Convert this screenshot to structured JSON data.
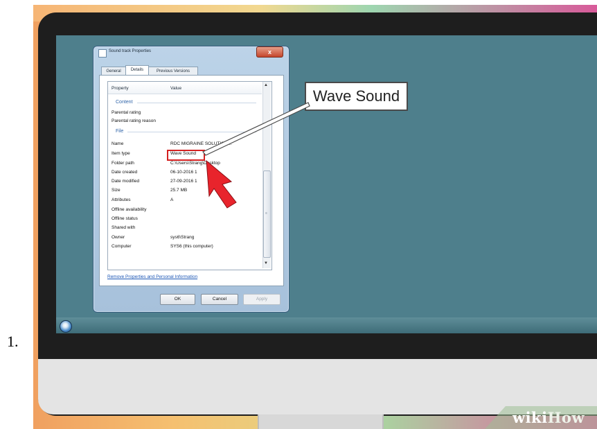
{
  "step_number": "1.",
  "watermark": {
    "part1": "wiki",
    "part2": "How"
  },
  "dialog": {
    "title": "Sound track Properties",
    "close_label": "x",
    "tabs": [
      "General",
      "Details",
      "Previous Versions"
    ],
    "active_tab": "Details",
    "columns": {
      "property": "Property",
      "value": "Value"
    },
    "sections": {
      "content": "Content",
      "file": "File"
    },
    "rows": [
      {
        "property": "Parental rating",
        "value": ""
      },
      {
        "property": "Parental rating reason",
        "value": ""
      },
      {
        "property": "Name",
        "value": "RDC MIGRAINE SOLUTION..."
      },
      {
        "property": "Item type",
        "value": "Wave Sound"
      },
      {
        "property": "Folder path",
        "value": "C:\\Users\\Strang\\Desktop"
      },
      {
        "property": "Date created",
        "value": "06-10-2016 1"
      },
      {
        "property": "Date modified",
        "value": "27-09-2016 1"
      },
      {
        "property": "Size",
        "value": "25.7 MB"
      },
      {
        "property": "Attributes",
        "value": "A"
      },
      {
        "property": "Offline availability",
        "value": ""
      },
      {
        "property": "Offline status",
        "value": ""
      },
      {
        "property": "Shared with",
        "value": ""
      },
      {
        "property": "Owner",
        "value": "sys6\\Strang"
      },
      {
        "property": "Computer",
        "value": "SYS6 (this computer)"
      }
    ],
    "remove_link": "Remove Properties and Personal Information",
    "buttons": {
      "ok": "OK",
      "cancel": "Cancel",
      "apply": "Apply"
    }
  },
  "callout": {
    "text": "Wave Sound"
  },
  "colors": {
    "desktop": "#4e7f8c",
    "highlight": "#d42020",
    "arrow": "#e8242c",
    "link": "#1b56b5"
  }
}
